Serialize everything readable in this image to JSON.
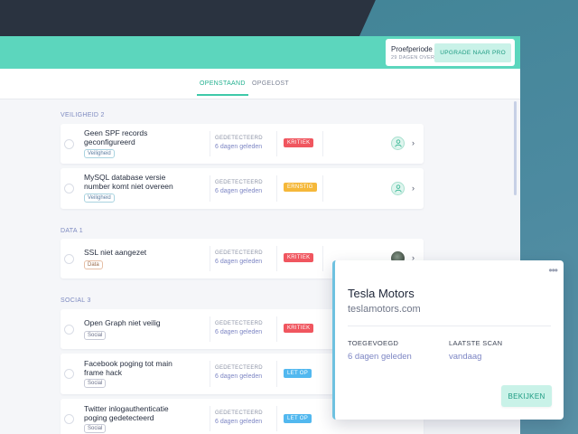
{
  "header": {
    "trial_title": "Proefperiode",
    "trial_days": "29 DAGEN OVER",
    "upgrade_label": "UPGRADE NAAR PRO"
  },
  "tabs": [
    {
      "label": "OPENSTAAND",
      "active": true
    },
    {
      "label": "OPGELOST",
      "active": false
    }
  ],
  "sections": [
    {
      "title": "VEILIGHEID 2",
      "items": [
        {
          "title": "Geen SPF records geconfigureerd",
          "tag": "Veiligheid",
          "detected_label": "GEDETECTEERD",
          "detected_time": "6 dagen geleden",
          "severity": "KRITIEK"
        },
        {
          "title": "MySQL database versie number komt niet overeen",
          "tag": "Veiligheid",
          "detected_label": "GEDETECTEERD",
          "detected_time": "6 dagen geleden",
          "severity": "ERNSTIG"
        }
      ]
    },
    {
      "title": "DATA 1",
      "items": [
        {
          "title": "SSL niet aangezet",
          "tag": "Data",
          "detected_label": "GEDETECTEERD",
          "detected_time": "6 dagen geleden",
          "severity": "KRITIEK"
        }
      ]
    },
    {
      "title": "SOCIAL 3",
      "items": [
        {
          "title": "Open Graph niet veilig",
          "tag": "Social",
          "detected_label": "GEDETECTEERD",
          "detected_time": "6 dagen geleden",
          "severity": "KRITIEK"
        },
        {
          "title": "Facebook poging tot main frame hack",
          "tag": "Social",
          "detected_label": "GEDETECTEERD",
          "detected_time": "6 dagen geleden",
          "severity": "LET OP"
        },
        {
          "title": "Twitter inlogauthenticatie poging gedetecteerd",
          "tag": "Social",
          "detected_label": "GEDETECTEERD",
          "detected_time": "6 dagen geleden",
          "severity": "LET OP"
        }
      ]
    }
  ],
  "popup": {
    "name": "Tesla Motors",
    "domain": "teslamotors.com",
    "added_label": "TOEGEVOEGD",
    "added_value": "6 dagen geleden",
    "scan_label": "LAATSTE SCAN",
    "scan_value": "vandaag",
    "button_label": "BEKIJKEN"
  },
  "colors": {
    "accent": "#5cd6bd",
    "kritiek": "#f0565f",
    "ernstig": "#f5b83a",
    "let_op": "#52b8ef"
  }
}
